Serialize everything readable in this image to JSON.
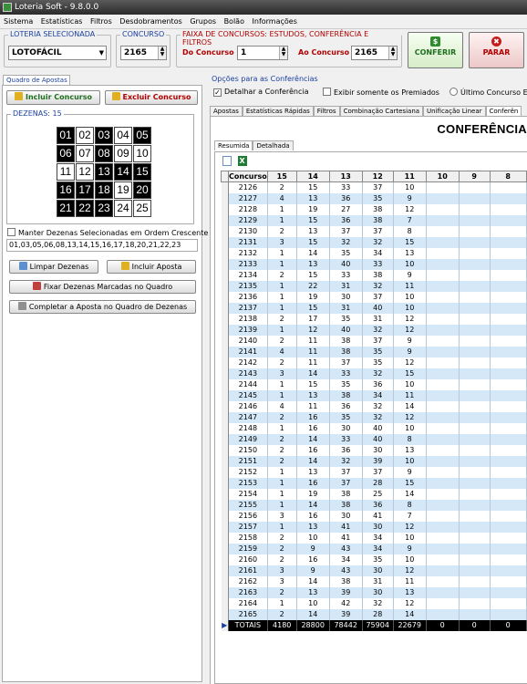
{
  "window": {
    "title": "Loteria Soft - 9.8.0.0"
  },
  "menu": [
    "Sistema",
    "Estatísticas",
    "Filtros",
    "Desdobramentos",
    "Grupos",
    "Bolão",
    "Informações"
  ],
  "loteria": {
    "title": "LOTERIA SELECIONADA",
    "value": "LOTOFÁCIL"
  },
  "concurso": {
    "title": "CONCURSO",
    "value": "2165"
  },
  "faixa": {
    "title": "FAIXA DE CONCURSOS: ESTUDOS, CONFERÊNCIA E FILTROS",
    "do_label": "Do Concurso",
    "do_value": "1",
    "ao_label": "Ao Concurso",
    "ao_value": "2165"
  },
  "buttons": {
    "conferir": "CONFERIR",
    "parar": "PARAR",
    "conferir_icon": "$",
    "parar_icon": "✖"
  },
  "left": {
    "tab": "Quadro de Apostas",
    "incluir_concurso": "Incluir Concurso",
    "excluir_concurso": "Excluir Concurso",
    "dezenas_title": "DEZENAS: 15",
    "dezenas": [
      {
        "n": "01",
        "on": true
      },
      {
        "n": "02",
        "on": false
      },
      {
        "n": "03",
        "on": true
      },
      {
        "n": "04",
        "on": false
      },
      {
        "n": "05",
        "on": true
      },
      {
        "n": "06",
        "on": true
      },
      {
        "n": "07",
        "on": false
      },
      {
        "n": "08",
        "on": true
      },
      {
        "n": "09",
        "on": false
      },
      {
        "n": "10",
        "on": false
      },
      {
        "n": "11",
        "on": false
      },
      {
        "n": "12",
        "on": false
      },
      {
        "n": "13",
        "on": true
      },
      {
        "n": "14",
        "on": true
      },
      {
        "n": "15",
        "on": true
      },
      {
        "n": "16",
        "on": true
      },
      {
        "n": "17",
        "on": true
      },
      {
        "n": "18",
        "on": true
      },
      {
        "n": "19",
        "on": false
      },
      {
        "n": "20",
        "on": true
      },
      {
        "n": "21",
        "on": true
      },
      {
        "n": "22",
        "on": true
      },
      {
        "n": "23",
        "on": true
      },
      {
        "n": "24",
        "on": false
      },
      {
        "n": "25",
        "on": false
      }
    ],
    "manter_label": "Manter Dezenas Selecionadas em Ordem Crescente",
    "selected_text": "01,03,05,06,08,13,14,15,16,17,18,20,21,22,23",
    "limpar": "Limpar Dezenas",
    "incluir_aposta": "Incluir Aposta",
    "fixar": "Fixar Dezenas Marcadas no Quadro",
    "completar": "Completar a Aposta no Quadro de Dezenas"
  },
  "options": {
    "title": "Opções para as Conferências",
    "detalhar": "Detalhar a Conferência",
    "exibir": "Exibir somente os Premiados",
    "ultimo": "Último Concurso Exis",
    "detalhar_checked": "✓"
  },
  "tabs": [
    "Apostas",
    "Estatísticas Rápidas",
    "Filtros",
    "Combinação Cartesiana",
    "Unificação Linear",
    "Conferên"
  ],
  "conf_title": "CONFERÊNCIA",
  "subtabs": [
    "Resumida",
    "Detalhada"
  ],
  "table": {
    "headers": [
      "Concurso",
      "15",
      "14",
      "13",
      "12",
      "11",
      "10",
      "9",
      "8"
    ],
    "rows": [
      [
        "2126",
        "2",
        "15",
        "33",
        "37",
        "10"
      ],
      [
        "2127",
        "4",
        "13",
        "36",
        "35",
        "9"
      ],
      [
        "2128",
        "1",
        "19",
        "27",
        "38",
        "12"
      ],
      [
        "2129",
        "1",
        "15",
        "36",
        "38",
        "7"
      ],
      [
        "2130",
        "2",
        "13",
        "37",
        "37",
        "8"
      ],
      [
        "2131",
        "3",
        "15",
        "32",
        "32",
        "15"
      ],
      [
        "2132",
        "1",
        "14",
        "35",
        "34",
        "13"
      ],
      [
        "2133",
        "1",
        "13",
        "40",
        "33",
        "10"
      ],
      [
        "2134",
        "2",
        "15",
        "33",
        "38",
        "9"
      ],
      [
        "2135",
        "1",
        "22",
        "31",
        "32",
        "11"
      ],
      [
        "2136",
        "1",
        "19",
        "30",
        "37",
        "10"
      ],
      [
        "2137",
        "1",
        "15",
        "31",
        "40",
        "10"
      ],
      [
        "2138",
        "2",
        "17",
        "35",
        "31",
        "12"
      ],
      [
        "2139",
        "1",
        "12",
        "40",
        "32",
        "12"
      ],
      [
        "2140",
        "2",
        "11",
        "38",
        "37",
        "9"
      ],
      [
        "2141",
        "4",
        "11",
        "38",
        "35",
        "9"
      ],
      [
        "2142",
        "2",
        "11",
        "37",
        "35",
        "12"
      ],
      [
        "2143",
        "3",
        "14",
        "33",
        "32",
        "15"
      ],
      [
        "2144",
        "1",
        "15",
        "35",
        "36",
        "10"
      ],
      [
        "2145",
        "1",
        "13",
        "38",
        "34",
        "11"
      ],
      [
        "2146",
        "4",
        "11",
        "36",
        "32",
        "14"
      ],
      [
        "2147",
        "2",
        "16",
        "35",
        "32",
        "12"
      ],
      [
        "2148",
        "1",
        "16",
        "30",
        "40",
        "10"
      ],
      [
        "2149",
        "2",
        "14",
        "33",
        "40",
        "8"
      ],
      [
        "2150",
        "2",
        "16",
        "36",
        "30",
        "13"
      ],
      [
        "2151",
        "2",
        "14",
        "32",
        "39",
        "10"
      ],
      [
        "2152",
        "1",
        "13",
        "37",
        "37",
        "9"
      ],
      [
        "2153",
        "1",
        "16",
        "37",
        "28",
        "15"
      ],
      [
        "2154",
        "1",
        "19",
        "38",
        "25",
        "14"
      ],
      [
        "2155",
        "1",
        "14",
        "38",
        "36",
        "8"
      ],
      [
        "2156",
        "3",
        "16",
        "30",
        "41",
        "7"
      ],
      [
        "2157",
        "1",
        "13",
        "41",
        "30",
        "12"
      ],
      [
        "2158",
        "2",
        "10",
        "41",
        "34",
        "10"
      ],
      [
        "2159",
        "2",
        "9",
        "43",
        "34",
        "9"
      ],
      [
        "2160",
        "2",
        "16",
        "34",
        "35",
        "10"
      ],
      [
        "2161",
        "3",
        "9",
        "43",
        "30",
        "12"
      ],
      [
        "2162",
        "3",
        "14",
        "38",
        "31",
        "11"
      ],
      [
        "2163",
        "2",
        "13",
        "39",
        "30",
        "13"
      ],
      [
        "2164",
        "1",
        "10",
        "42",
        "32",
        "12"
      ],
      [
        "2165",
        "2",
        "14",
        "39",
        "28",
        "14"
      ]
    ],
    "totals": [
      "TOTAIS",
      "4180",
      "28800",
      "78442",
      "75904",
      "22679",
      "0",
      "0",
      "0"
    ]
  }
}
